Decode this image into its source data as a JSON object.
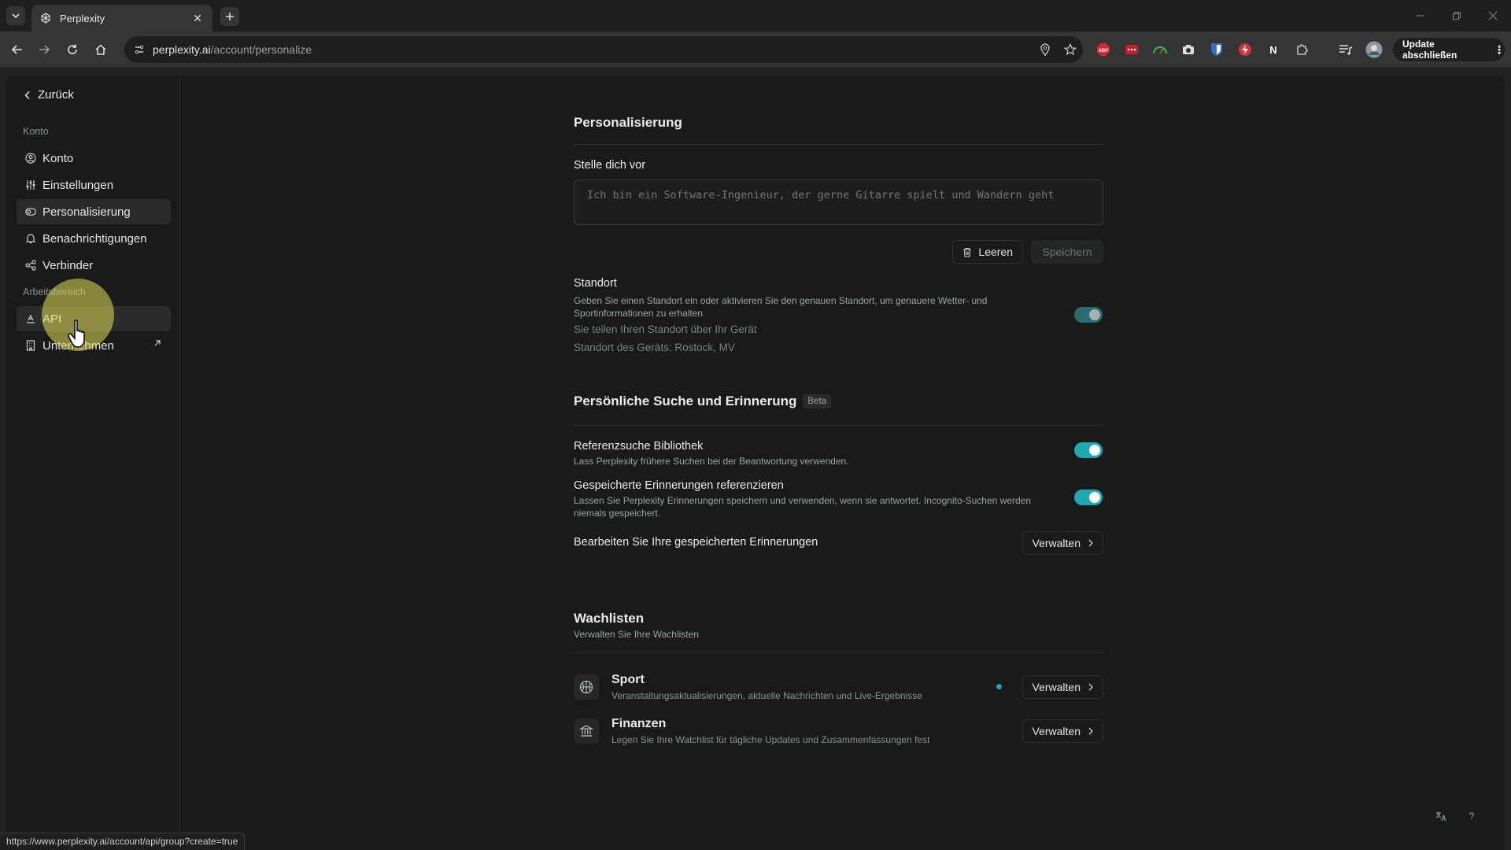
{
  "browser": {
    "tab_title": "Perplexity",
    "url_domain": "perplexity.ai",
    "url_path": "/account/personalize",
    "update_label": "Update abschließen",
    "status_url": "https://www.perplexity.ai/account/api/group?create=true",
    "extensions": [
      "ABP",
      "",
      "",
      "",
      "",
      "",
      "N"
    ]
  },
  "sidebar": {
    "back_label": "Zurück",
    "section_account": "Konto",
    "section_workspace": "Arbeitsbereich",
    "items": [
      {
        "label": "Konto",
        "icon": "user-circle-icon"
      },
      {
        "label": "Einstellungen",
        "icon": "sliders-icon"
      },
      {
        "label": "Personalisierung",
        "icon": "toggle-icon",
        "active": true
      },
      {
        "label": "Benachrichtigungen",
        "icon": "bell-icon"
      },
      {
        "label": "Verbinder",
        "icon": "connector-icon"
      }
    ],
    "workspace_items": [
      {
        "label": "API",
        "icon": "api-icon"
      },
      {
        "label": "Unternehmen",
        "icon": "building-icon",
        "external": true
      }
    ]
  },
  "personalization": {
    "title": "Personalisierung",
    "intro_label": "Stelle dich vor",
    "intro_placeholder": "Ich bin ein Software-Ingenieur, der gerne Gitarre spielt und Wandern geht",
    "clear_label": "Leeren",
    "save_label": "Speichern",
    "location": {
      "title": "Standort",
      "description": "Geben Sie einen Standort ein oder aktivieren Sie den genauen Standort, um genauere Wetter- und Sportinformationen zu erhalten",
      "sharing_note": "Sie teilen Ihren Standort über Ihr Gerät",
      "device_location": "Standort des Geräts: Rostock, MV",
      "enabled": true
    }
  },
  "memory": {
    "title": "Persönliche Suche und Erinnerung",
    "badge": "Beta",
    "library": {
      "title": "Referenzsuche Bibliothek",
      "description": "Lass Perplexity frühere Suchen bei der Beantwortung verwenden.",
      "enabled": true
    },
    "saved_memories": {
      "title": "Gespeicherte Erinnerungen referenzieren",
      "description": "Lassen Sie Perplexity Erinnerungen speichern und verwenden, wenn sie antwortet. Incognito-Suchen werden niemals gespeichert.",
      "enabled": true
    },
    "edit": {
      "title": "Bearbeiten Sie Ihre gespeicherten Erinnerungen",
      "button": "Verwalten"
    }
  },
  "watchlists": {
    "title": "Wachlisten",
    "subtitle": "Verwalten Sie Ihre Wachlisten",
    "items": [
      {
        "title": "Sport",
        "description": "Veranstaltungsaktualisierungen, aktuelle Nachrichten und Live-Ergebnisse",
        "button": "Verwalten",
        "icon": "basketball-icon",
        "active": true
      },
      {
        "title": "Finanzen",
        "description": "Legen Sie Ihre Watchlist für tägliche Updates und Zusammenfassungen fest",
        "button": "Verwalten",
        "icon": "bank-icon",
        "active": false
      }
    ]
  },
  "corner": {
    "translate_icon": "translate-icon",
    "help_label": "?"
  },
  "colors": {
    "accent": "#1fa7b4",
    "background": "#191a1a"
  }
}
